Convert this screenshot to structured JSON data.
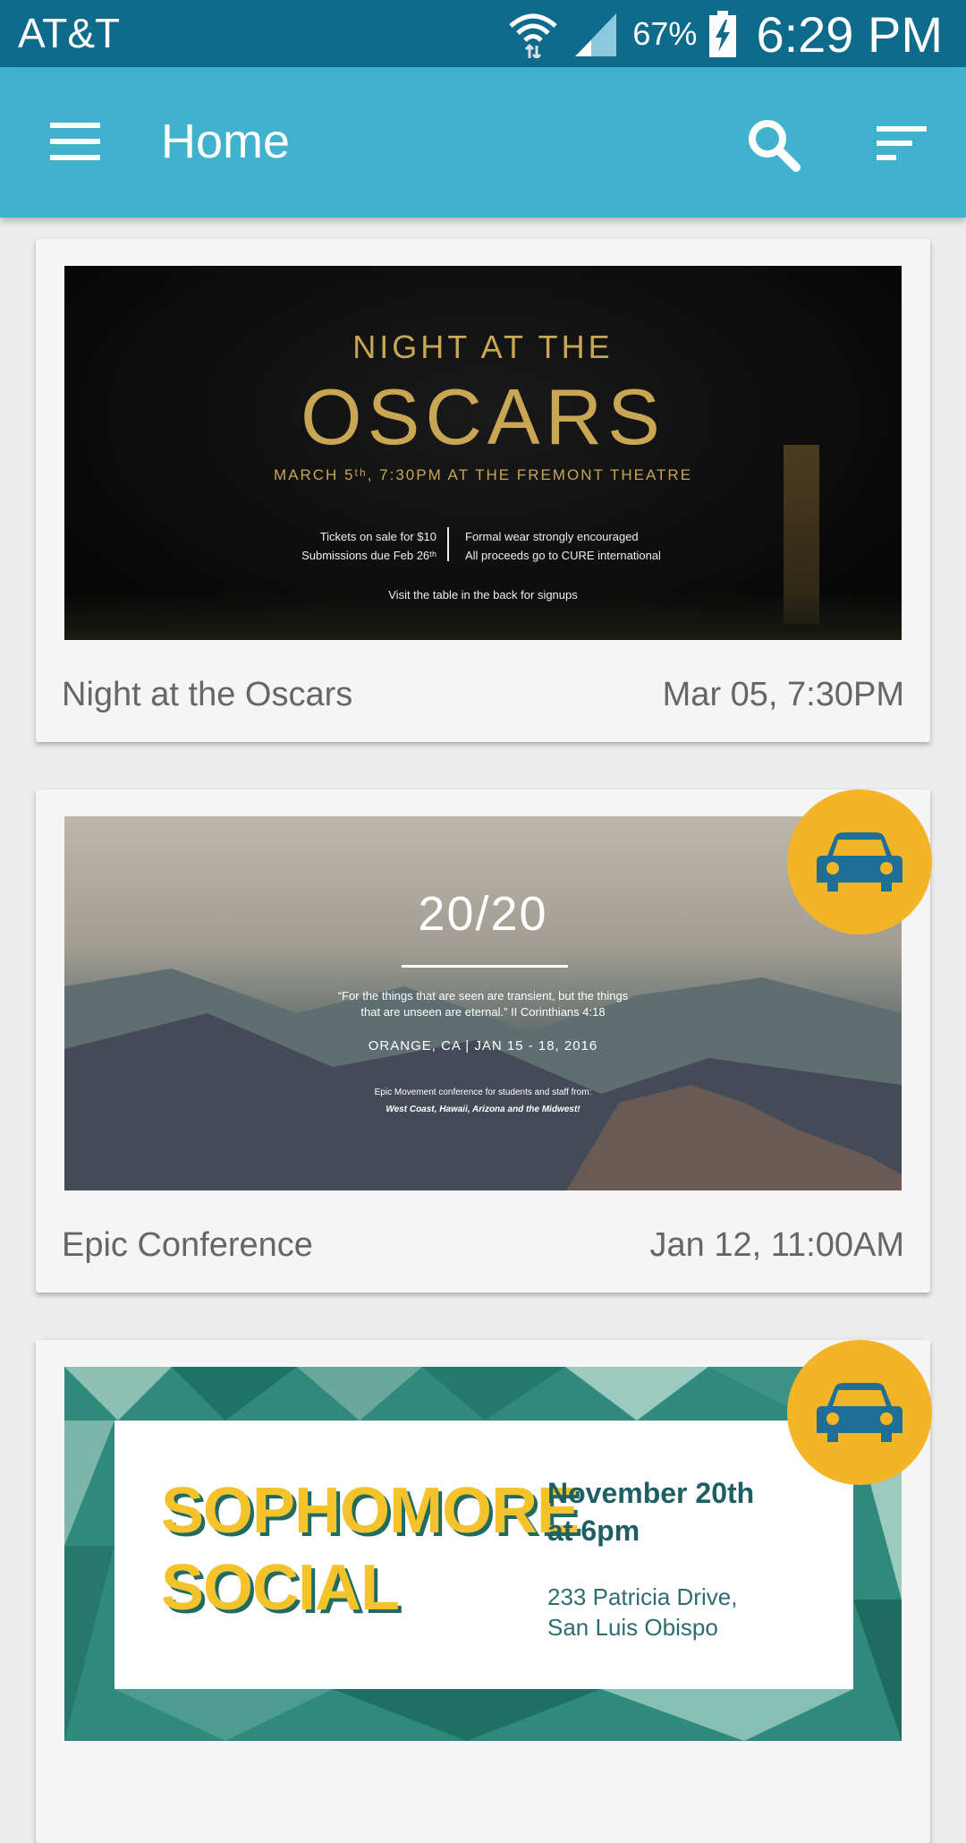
{
  "status_bar": {
    "carrier": "AT&T",
    "battery": "67%",
    "time": "6:29 PM"
  },
  "app_bar": {
    "title": "Home",
    "menu_icon": "hamburger-menu-icon",
    "search_icon": "search-icon",
    "sort_icon": "sort-icon"
  },
  "colors": {
    "status_bar": "#0e6b8c",
    "app_bar": "#40b2cd",
    "fab": "#f4b427",
    "fab_icon": "#1e6f96",
    "background": "#ececec",
    "card": "#f5f5f5"
  },
  "events": [
    {
      "name": "Night at the Oscars",
      "date": "Mar 05, 7:30PM",
      "has_ride_button": false,
      "poster": {
        "line1": "NIGHT AT THE",
        "line2": "OSCARS",
        "line3": "MARCH 5ᵗʰ, 7:30PM AT THE FREMONT THEATRE",
        "left_a": "Tickets on sale for $10",
        "left_b": "Submissions due Feb 26ᵗʰ",
        "right_a": "Formal wear strongly encouraged",
        "right_b": "All proceeds go to CURE international",
        "footer": "Visit the table in the back for signups"
      }
    },
    {
      "name": "Epic Conference",
      "date": "Jan 12, 11:00AM",
      "has_ride_button": true,
      "ride_icon": "car-icon",
      "poster": {
        "title": "20/20",
        "quote_a": "“For the things that are seen are transient, but the things",
        "quote_b": "that are unseen are eternal.” II Corinthians 4:18",
        "location": "ORANGE, CA  |  JAN 15 - 18, 2016",
        "sub": "Epic Movement conference for students and staff from:",
        "sub_bold": "West Coast, Hawaii, Arizona and the Midwest!"
      }
    },
    {
      "name": "Sophomore Social",
      "has_ride_button": true,
      "ride_icon": "car-icon",
      "poster": {
        "line1": "SOPHOMORE",
        "line2": "SOCIAL",
        "date_a": "November 20th",
        "date_b": "at 6pm",
        "addr_a": "233 Patricia Drive,",
        "addr_b": "San Luis Obispo"
      }
    }
  ]
}
